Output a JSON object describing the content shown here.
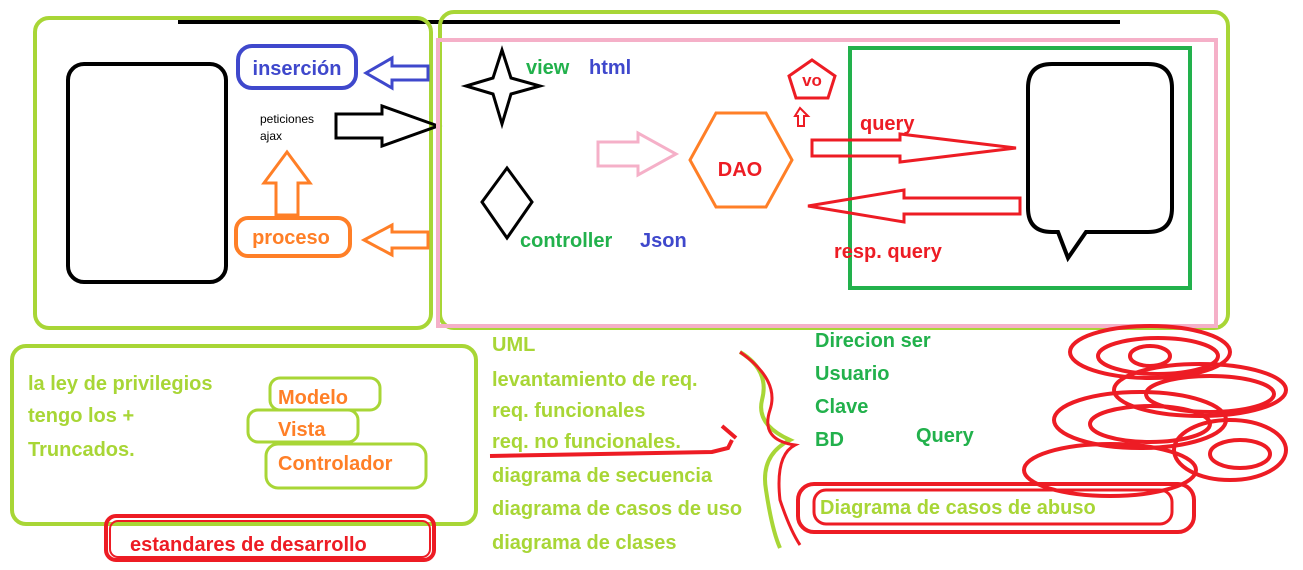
{
  "colors": {
    "lime": "#a8d636",
    "blue": "#3f48cc",
    "orange": "#ff7f27",
    "red": "#ed1c24",
    "green": "#22b14c",
    "pink": "#f5b0c8",
    "black": "#000000"
  },
  "client": {
    "insercion": "inserción",
    "peticiones_line1": "peticiones",
    "peticiones_line2": "ajax",
    "proceso": "proceso"
  },
  "server": {
    "view": "view",
    "html": "html",
    "controller": "controller",
    "json": "Json",
    "dao": "DAO",
    "vo": "vo",
    "query": "query",
    "resp_query": "resp. query"
  },
  "mvc": {
    "line1": "la ley de privilegios",
    "line2": "tengo los +",
    "line3": "Truncados.",
    "modelo": "Modelo",
    "vista": "Vista",
    "controlador": "Controlador",
    "estandares": "estandares de desarrollo"
  },
  "uml": {
    "items": [
      "UML",
      "levantamiento de req.",
      "req. funcionales",
      "req. no funcionales.",
      "diagrama de secuencia",
      "diagrama de casos de uso",
      "diagrama de clases"
    ]
  },
  "conn": {
    "items": [
      "Direcion ser",
      "Usuario",
      "Clave",
      "BD"
    ],
    "query": "Query",
    "abuso": "Diagrama de casos de abuso"
  }
}
